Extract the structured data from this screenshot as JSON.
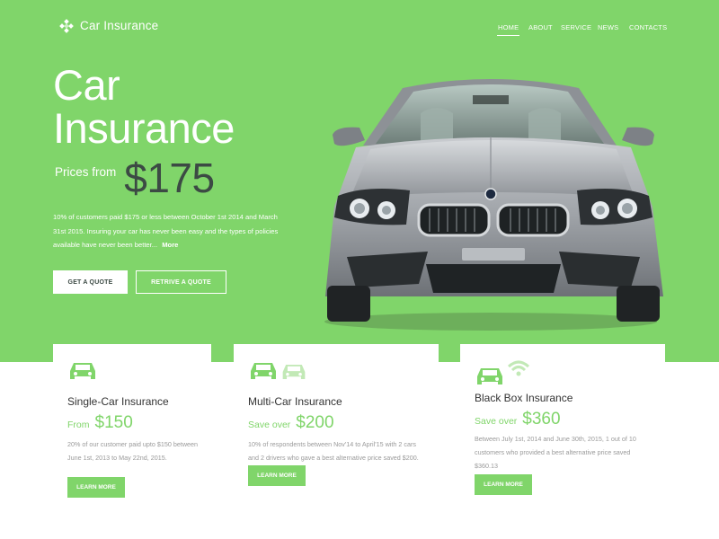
{
  "brand": {
    "title": "Car Insurance",
    "icon": "diamond-dots-logo-icon"
  },
  "nav": {
    "items": [
      {
        "label": "HOME",
        "active": true
      },
      {
        "label": "ABOUT",
        "active": false
      },
      {
        "label": "SERVICE",
        "active": false
      },
      {
        "label": "NEWS",
        "active": false
      },
      {
        "label": "CONTACTS",
        "active": false
      }
    ]
  },
  "hero": {
    "headline_line1": "Car",
    "headline_line2": "Insurance",
    "prices_from_label": "Prices from",
    "price": "$175",
    "description": "10% of customers paid $175 or less between October 1st 2014 and March 31st 2015. Insuring your car has never been easy and the types of policies available have never been better...",
    "more_link": "More",
    "primary_button": "GET A QUOTE",
    "secondary_button": "RETRIVE A QUOTE",
    "image": "silver-sedan-front-view"
  },
  "cards": [
    {
      "icons": [
        "car-icon"
      ],
      "title": "Single-Car Insurance",
      "price_label": "From",
      "price": "$150",
      "description": "20% of our customer paid upto $150 between June 1st, 2013 to May 22nd, 2015.",
      "button": "LEARN MORE"
    },
    {
      "icons": [
        "car-icon",
        "car-light-icon"
      ],
      "title": "Multi-Car Insurance",
      "price_label": "Save over",
      "price": "$200",
      "description": "10% of respondents between Nov'14 to April'15 with 2 cars and 2 drivers who gave a best alternative price saved $200.",
      "button": "LEARN MORE"
    },
    {
      "icons": [
        "car-icon",
        "wifi-signal-icon"
      ],
      "title": "Black Box Insurance",
      "price_label": "Save over",
      "price": "$360",
      "description": "Between July 1st, 2014 and June 30th, 2015, 1 out of 10 customers who provided a best alternative price saved $360.13",
      "button": "LEARN MORE"
    }
  ],
  "colors": {
    "accent": "#80d56a",
    "dark": "#3c4a44",
    "muted_text": "#9a9a9a"
  }
}
